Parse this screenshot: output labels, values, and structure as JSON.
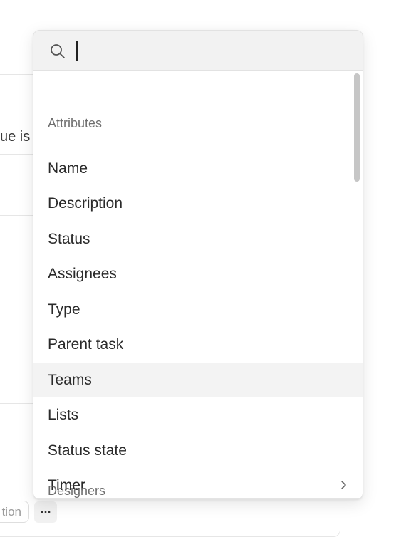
{
  "background": {
    "partial_text": "ue is",
    "chip_label": "tion",
    "more_label": "···"
  },
  "search": {
    "value": "",
    "placeholder": ""
  },
  "sections": [
    {
      "header": "Attributes",
      "items": [
        {
          "label": "Name"
        },
        {
          "label": "Description"
        },
        {
          "label": "Status"
        },
        {
          "label": "Assignees"
        },
        {
          "label": "Type"
        },
        {
          "label": "Parent task"
        },
        {
          "label": "Teams",
          "highlighted": true
        },
        {
          "label": "Lists"
        },
        {
          "label": "Status state"
        },
        {
          "label": "Timer",
          "has_submenu": true
        }
      ]
    },
    {
      "header": "Designers",
      "items": []
    }
  ],
  "icons": {
    "search": "search-icon",
    "submenu": "chevron-right-icon"
  },
  "colors": {
    "search_bar_bg": "#f2f2f2",
    "highlight_bg": "#f3f3f3",
    "section_header": "#6f6f6f",
    "item_text": "#2a2a2a",
    "scrollbar_thumb": "#c6c6c6"
  }
}
